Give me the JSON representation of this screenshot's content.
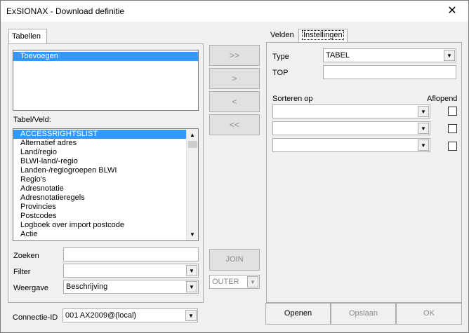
{
  "window": {
    "title": "ExSIONAX - Download definitie",
    "close_glyph": "✕"
  },
  "left": {
    "tab_label": "Tabellen",
    "tables_list": [
      "Toevoegen"
    ],
    "tabel_veld_label": "Tabel/Veld:",
    "fields": [
      "ACCESSRIGHTSLIST",
      "Alternatief adres",
      "Land/regio",
      "BLWI-land/-regio",
      "Landen-/regiogroepen BLWI",
      "Regio's",
      "Adresnotatie",
      "Adresnotatieregels",
      "Provincies",
      "Postcodes",
      "Logboek over import postcode",
      "Actie"
    ],
    "zoeken_label": "Zoeken",
    "zoeken_value": "",
    "filter_label": "Filter",
    "filter_value": "",
    "weergave_label": "Weergave",
    "weergave_value": "Beschrijving",
    "connectie_label": "Connectie-ID",
    "connectie_value": "001 AX2009@(local)"
  },
  "middle": {
    "add_all": ">>",
    "add_one": ">",
    "remove_one": "<",
    "remove_all": "<<",
    "join": "JOIN",
    "outer_value": "OUTER"
  },
  "right": {
    "tab_velden": "Velden",
    "tab_instellingen": "Instellingen",
    "type_label": "Type",
    "type_value": "TABEL",
    "top_label": "TOP",
    "top_value": "",
    "sorteren_label": "Sorteren op",
    "aflopend_label": "Aflopend",
    "sort_rows": [
      {
        "field": "",
        "desc": false
      },
      {
        "field": "",
        "desc": false
      },
      {
        "field": "",
        "desc": false
      }
    ]
  },
  "buttons": {
    "openen": "Openen",
    "opslaan": "Opslaan",
    "ok": "OK"
  }
}
